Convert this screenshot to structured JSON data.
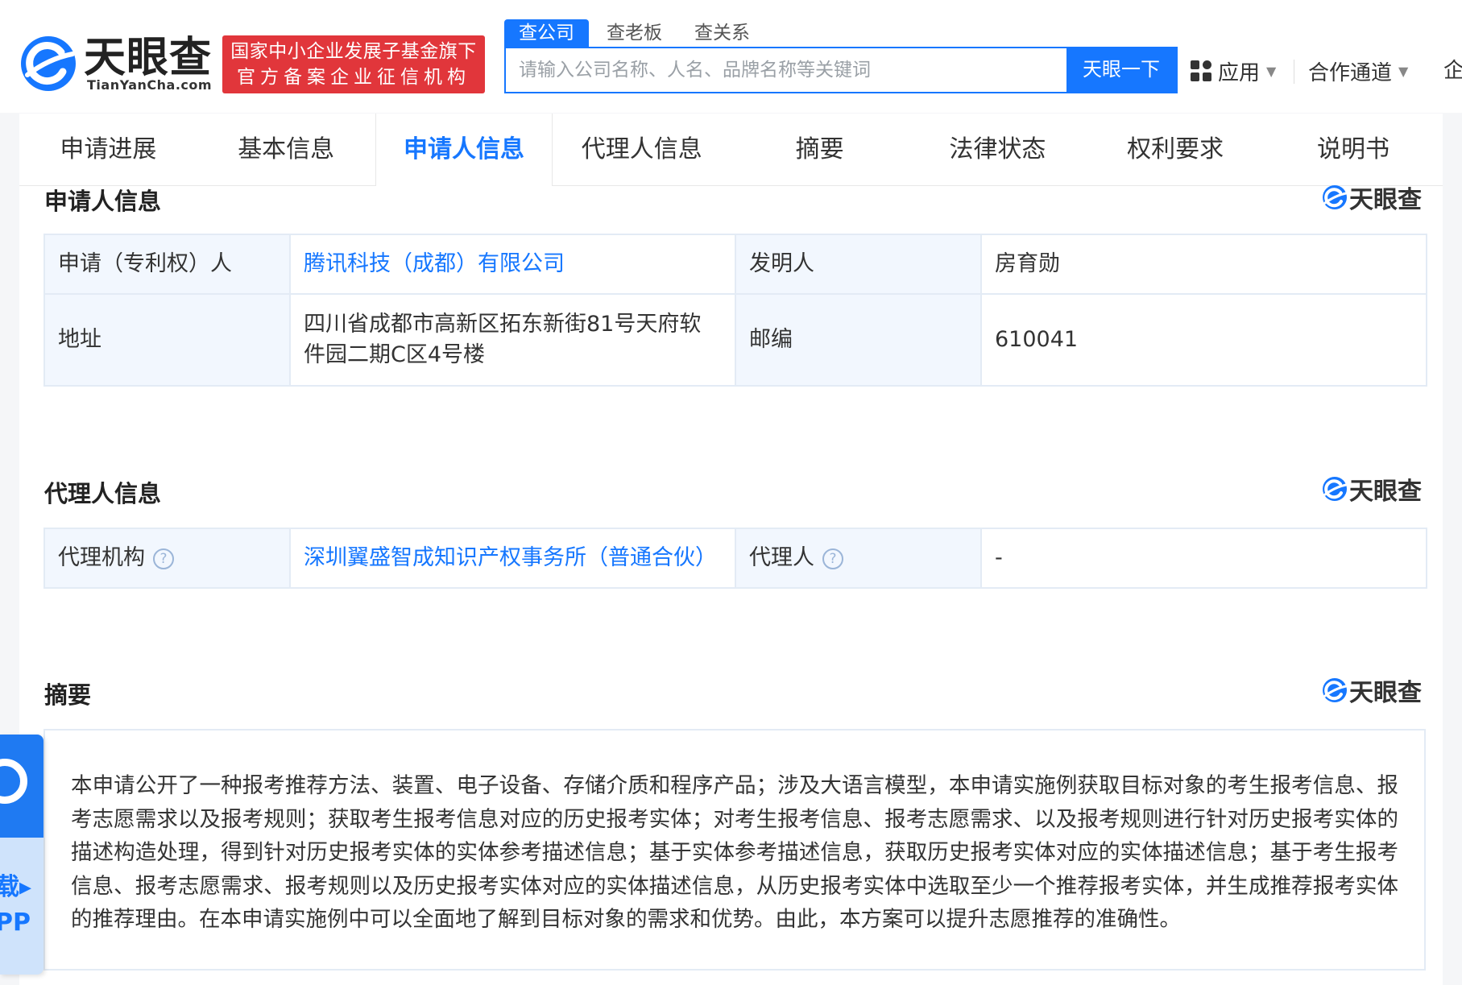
{
  "header": {
    "logo": {
      "name": "天眼查",
      "domain": "TianYanCha.com"
    },
    "badge": {
      "line1": "国家中小企业发展子基金旗下",
      "line2": "官方备案企业征信机构"
    },
    "search_tabs": [
      "查公司",
      "查老板",
      "查关系"
    ],
    "search": {
      "placeholder": "请输入公司名称、人名、品牌名称等关键词",
      "value": "",
      "button": "天眼一下"
    },
    "apps_label": "应用",
    "coop_label": "合作通道",
    "cut_label": "企",
    "colors": {
      "accent": "#1677ff",
      "badge_red": "#e1363b"
    }
  },
  "nav": {
    "items": [
      "申请进展",
      "基本信息",
      "申请人信息",
      "代理人信息",
      "摘要",
      "法律状态",
      "权利要求",
      "说明书"
    ],
    "active_index": 2
  },
  "watermark": "天眼查",
  "applicant": {
    "title": "申请人信息",
    "rows": [
      {
        "k1": "申请（专利权）人",
        "v1": "腾讯科技（成都）有限公司",
        "k2": "发明人",
        "v2": "房育勋"
      },
      {
        "k1": "地址",
        "v1": "四川省成都市高新区拓东新街81号天府软件园二期C区4号楼",
        "k2": "邮编",
        "v2": "610041"
      }
    ]
  },
  "agent": {
    "title": "代理人信息",
    "agency_label": "代理机构",
    "agency_value": "深圳翼盛智成知识产权事务所（普通合伙）",
    "agent_label": "代理人",
    "agent_value": "-"
  },
  "abstract": {
    "title": "摘要",
    "text": "本申请公开了一种报考推荐方法、装置、电子设备、存储介质和程序产品；涉及大语言模型，本申请实施例获取目标对象的考生报考信息、报考志愿需求以及报考规则；获取考生报考信息对应的历史报考实体；对考生报考信息、报考志愿需求、以及报考规则进行针对历史报考实体的描述构造处理，得到针对历史报考实体的实体参考描述信息；基于实体参考描述信息，获取历史报考实体对应的实体描述信息；基于考生报考信息、报考志愿需求、报考规则以及历史报考实体对应的实体描述信息，从历史报考实体中选取至少一个推荐报考实体，并生成推荐报考实体的推荐理由。在本申请实施例中可以全面地了解到目标对象的需求和优势。由此，本方案可以提升志愿推荐的准确性。"
  },
  "side_app": {
    "text_line1": "载▸",
    "text_line2": "PP"
  }
}
